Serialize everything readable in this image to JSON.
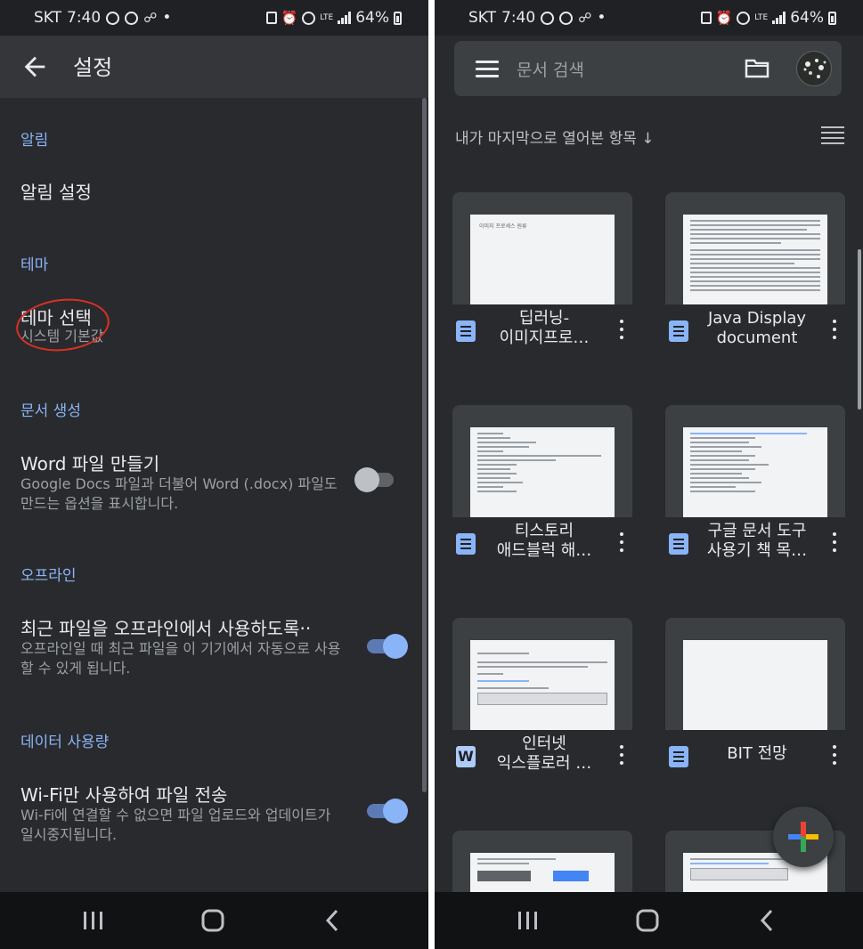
{
  "status_bar": {
    "carrier": "SKT",
    "time": "7:40",
    "battery": "64%",
    "lte_label": "LTE"
  },
  "left": {
    "title": "설정",
    "sections": {
      "notifications": {
        "header": "알림",
        "item_title": "알림 설정"
      },
      "theme": {
        "header": "테마",
        "item_title": "테마 선택",
        "item_sub": "시스템 기본값"
      },
      "doc_creation": {
        "header": "문서 생성",
        "item_title": "Word 파일 만들기",
        "item_sub": "Google Docs 파일과 더불어 Word (.docx) 파일도 만드는 옵션을 표시합니다.",
        "toggle_on": false
      },
      "offline": {
        "header": "오프라인",
        "item_title": "최근 파일을 오프라인에서 사용하도록··",
        "item_sub": "오프라인일 때 최근 파일을 이 기기에서 자동으로 사용할 수 있게 됩니다.",
        "toggle_on": true
      },
      "data_usage": {
        "header": "데이터 사용량",
        "item_title": "Wi-Fi만 사용하여 파일 전송",
        "item_sub": "Wi-Fi에 연결할 수 없으면 파일 업로드와 업데이트가 일시중지됩니다.",
        "toggle_on": true
      }
    },
    "colors": {
      "accent": "#8ab4f8",
      "annotation": "#d93025"
    }
  },
  "right": {
    "search": {
      "placeholder": "문서 검색"
    },
    "sort_label": "내가 마지막으로 열어본 항목 ↓",
    "docs": [
      {
        "title": "딥러닝-\n이미지프로…",
        "type": "docs",
        "thumb_heading": "이미지 프로세스 원류"
      },
      {
        "title": "Java Display\ndocument",
        "type": "docs",
        "thumb_heading": ""
      },
      {
        "title": "티스토리\n애드블럭 해…",
        "type": "docs",
        "thumb_heading": ""
      },
      {
        "title": "구글 문서 도구\n사용기 책 목…",
        "type": "docs",
        "thumb_heading": ""
      },
      {
        "title": "인터넷\n익스플로러 …",
        "type": "word",
        "thumb_heading": ""
      },
      {
        "title": "BIT 전망",
        "type": "docs",
        "thumb_heading": ""
      }
    ],
    "word_icon_label": "W"
  }
}
